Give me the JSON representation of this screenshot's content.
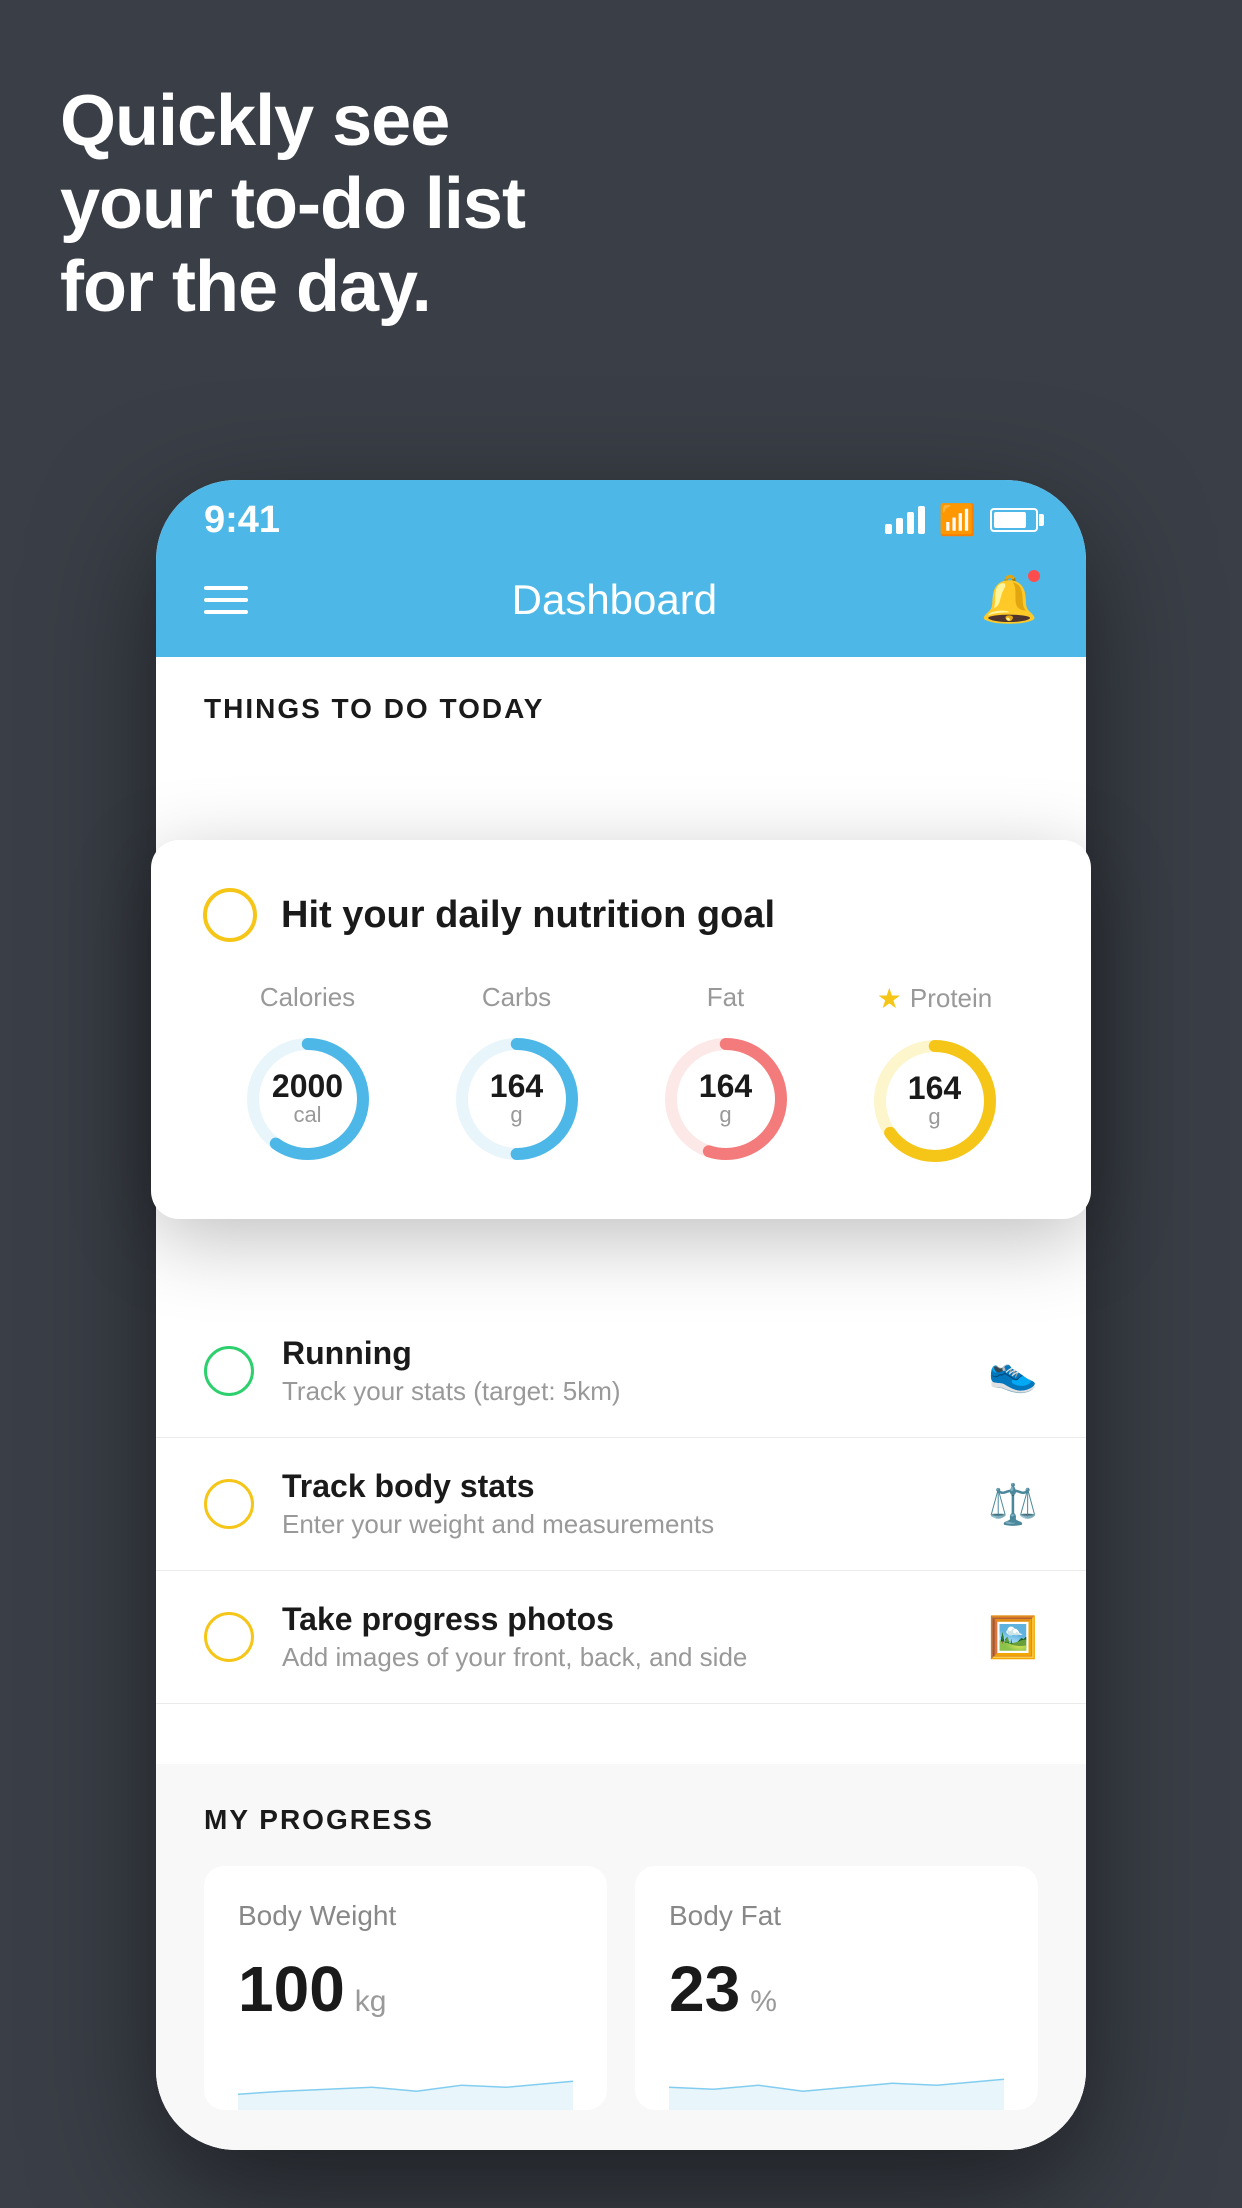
{
  "hero": {
    "line1": "Quickly see",
    "line2": "your to-do list",
    "line3": "for the day."
  },
  "status_bar": {
    "time": "9:41"
  },
  "header": {
    "title": "Dashboard"
  },
  "things_section": {
    "title": "THINGS TO DO TODAY"
  },
  "floating_card": {
    "checkbox_color": "yellow",
    "title": "Hit your daily nutrition goal",
    "nutrition": [
      {
        "label": "Calories",
        "value": "2000",
        "unit": "cal",
        "color": "#4db8e8",
        "percent": 60,
        "starred": false
      },
      {
        "label": "Carbs",
        "value": "164",
        "unit": "g",
        "color": "#4db8e8",
        "percent": 50,
        "starred": false
      },
      {
        "label": "Fat",
        "value": "164",
        "unit": "g",
        "color": "#f47b7b",
        "percent": 55,
        "starred": false
      },
      {
        "label": "Protein",
        "value": "164",
        "unit": "g",
        "color": "#f5c518",
        "percent": 65,
        "starred": true
      }
    ]
  },
  "todo_items": [
    {
      "id": "running",
      "circle_color": "green",
      "title": "Running",
      "subtitle": "Track your stats (target: 5km)",
      "icon": "shoe"
    },
    {
      "id": "body-stats",
      "circle_color": "yellow",
      "title": "Track body stats",
      "subtitle": "Enter your weight and measurements",
      "icon": "scale"
    },
    {
      "id": "progress-photos",
      "circle_color": "yellow",
      "title": "Take progress photos",
      "subtitle": "Add images of your front, back, and side",
      "icon": "person"
    }
  ],
  "progress": {
    "title": "MY PROGRESS",
    "cards": [
      {
        "id": "body-weight",
        "title": "Body Weight",
        "value": "100",
        "unit": "kg"
      },
      {
        "id": "body-fat",
        "title": "Body Fat",
        "value": "23",
        "unit": "%"
      }
    ]
  }
}
